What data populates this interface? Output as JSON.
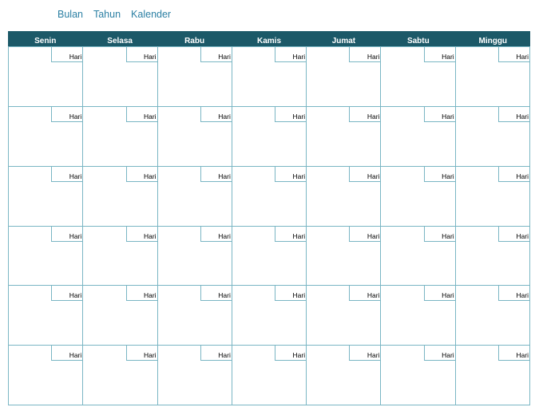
{
  "header": {
    "title_parts": [
      "Bulan",
      "Tahun",
      "Kalender"
    ]
  },
  "calendar": {
    "weekdays": [
      "Senin",
      "Selasa",
      "Rabu",
      "Kamis",
      "Jumat",
      "Sabtu",
      "Minggu"
    ],
    "day_label": "Hari",
    "rows": 6,
    "colors": {
      "header_bg": "#1c5968",
      "grid_line": "#7ab6c4",
      "title_text": "#2b7fa3"
    }
  }
}
